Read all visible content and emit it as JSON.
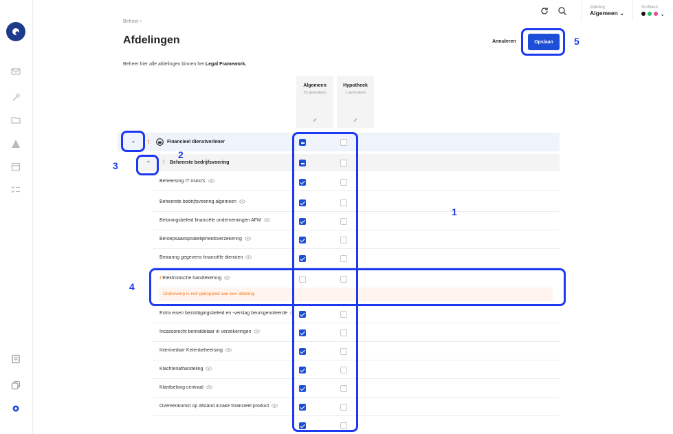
{
  "topbar": {
    "dept_label": "Afdeling",
    "dept_value": "Algemeen",
    "profiles_label": "Profielen",
    "profile_colors": [
      "#111111",
      "#22c55e",
      "#ec4899"
    ]
  },
  "breadcrumb": "Beheer",
  "title": "Afdelingen",
  "description_prefix": "Beheer hier alle afdelingen binnen het ",
  "description_bold": "Legal Framework.",
  "actions": {
    "cancel": "Annuleren",
    "save": "Opslaan"
  },
  "columns": [
    {
      "name": "Algemeen",
      "count": "29 gebruikers"
    },
    {
      "name": "Hypotheek",
      "count": "1 gebruikers"
    }
  ],
  "group1": {
    "label": "Financieel dienstverlener",
    "algemeen": "indeterminate",
    "hypotheek": "off"
  },
  "group2": {
    "label": "Beheerste bedrijfsvoering",
    "algemeen": "indeterminate",
    "hypotheek": "off"
  },
  "rows": [
    {
      "label": "Beheersing IT risico's",
      "algemeen": true,
      "hypotheek": false
    },
    {
      "label": "Beheerste bedrijfsvoering algemeen",
      "algemeen": true,
      "hypotheek": false
    },
    {
      "label": "Beloningsbeleid financiële ondernemingen AFM",
      "algemeen": true,
      "hypotheek": false
    },
    {
      "label": "Beroepsaansprakelijkheidsverzekering",
      "algemeen": true,
      "hypotheek": false
    },
    {
      "label": "Bewaring gegevens financiële diensten",
      "algemeen": true,
      "hypotheek": false
    },
    {
      "label": "Elektronische handtekening",
      "algemeen": false,
      "hypotheek": false,
      "warning": "Onderwerp is niet gekoppeld aan een afdeling."
    },
    {
      "label": "Extra eisen bezoldigingsbeleid en -verslag beursgenoteerde",
      "algemeen": true,
      "hypotheek": false
    },
    {
      "label": "Incassorecht bemiddelaar in verzekeringen",
      "algemeen": true,
      "hypotheek": false
    },
    {
      "label": "Intermediair Ketenbeheersing",
      "algemeen": true,
      "hypotheek": false
    },
    {
      "label": "Klachtenafhandeling",
      "algemeen": true,
      "hypotheek": false
    },
    {
      "label": "Klantbelang centraal",
      "algemeen": true,
      "hypotheek": false
    },
    {
      "label": "Overeenkomst op afstand inzake financieel product",
      "algemeen": true,
      "hypotheek": false
    },
    {
      "label": "",
      "algemeen": true,
      "hypotheek": false
    }
  ],
  "annotations": [
    "1",
    "2",
    "3",
    "4",
    "5"
  ],
  "accent": "#1d4ed8",
  "annotation_color": "#1d39f0"
}
